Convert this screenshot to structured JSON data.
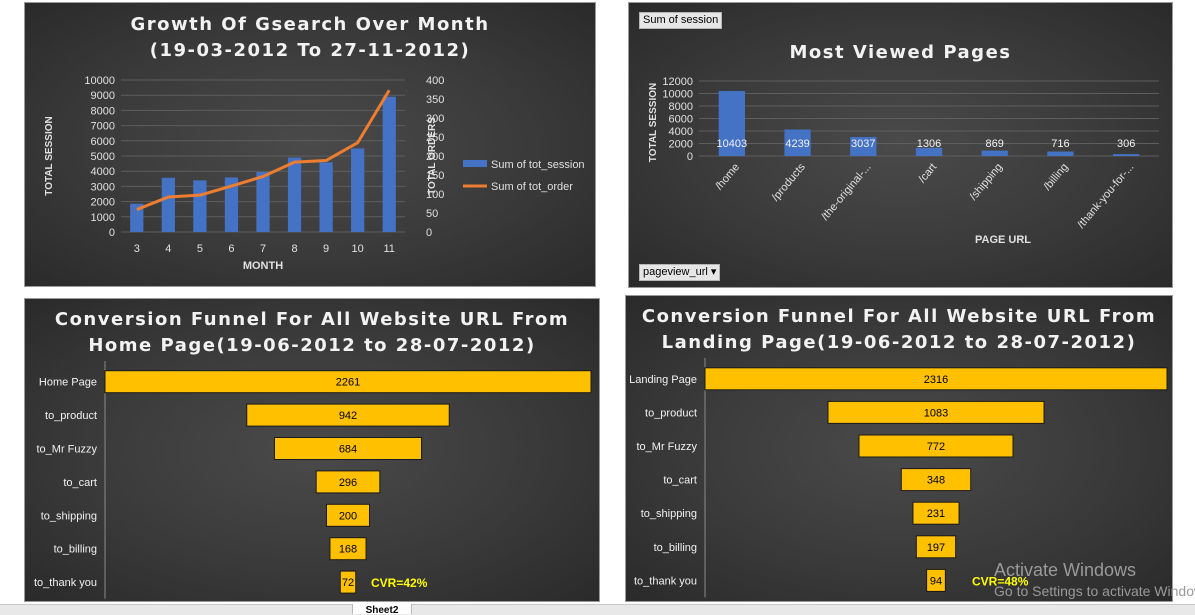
{
  "growth": {
    "title_line1": "Growth Of Gsearch Over Month",
    "title_line2": "(19-03-2012 To 27-11-2012)"
  },
  "views": {
    "title": "Most Viewed Pages",
    "filter_button": "Sum of session",
    "field_button": "pageview_url ▾"
  },
  "funnel_home": {
    "title_line1": "Conversion Funnel For All Website URL From",
    "title_line2": "Home Page(19-06-2012 to 28-07-2012)"
  },
  "funnel_landing": {
    "title_line1": "Conversion Funnel For All Website URL From",
    "title_line2": "Landing Page(19-06-2012 to 28-07-2012)"
  },
  "os_overlay": {
    "activate_title": "Activate Windows",
    "activate_sub": "Go to Settings to activate Windows."
  },
  "sheet_tab": "Sheet2",
  "colors": {
    "bar_blue": "#4472C4",
    "line_orange": "#ED7D31",
    "funnel_gold": "#FFC000",
    "cvr_yellow": "#FFFF00"
  },
  "chart_data": [
    {
      "type": "bar",
      "title": "Growth Of Gsearch Over Month (19-03-2012 To 27-11-2012)",
      "xlabel": "MONTH",
      "ylabel": "TOTAL SESSION",
      "y2label": "TOTAL ORDERS",
      "categories": [
        "3",
        "4",
        "5",
        "6",
        "7",
        "8",
        "9",
        "10",
        "11"
      ],
      "ylim": [
        0,
        10000
      ],
      "yticks": [
        0,
        1000,
        2000,
        3000,
        4000,
        5000,
        6000,
        7000,
        8000,
        9000,
        10000
      ],
      "y2lim": [
        0,
        400
      ],
      "y2ticks": [
        0,
        50,
        100,
        150,
        200,
        250,
        300,
        350,
        400
      ],
      "legend_position": "right",
      "grid": true,
      "series": [
        {
          "name": "Sum of tot_session",
          "kind": "bar",
          "axis": "left",
          "values": [
            1860,
            3570,
            3400,
            3590,
            3950,
            4900,
            4580,
            5500,
            8900
          ]
        },
        {
          "name": "Sum of tot_order",
          "kind": "line",
          "axis": "right",
          "values": [
            59,
            92,
            97,
            121,
            146,
            184,
            188,
            235,
            373
          ]
        }
      ]
    },
    {
      "type": "bar",
      "title": "Most Viewed Pages",
      "xlabel": "PAGE URL",
      "ylabel": "TOTAL SESSION",
      "categories": [
        "/home",
        "/products",
        "/the-original-...",
        "/cart",
        "/shipping",
        "/billing",
        "/thank-you-for-..."
      ],
      "values": [
        10403,
        4239,
        3037,
        1306,
        869,
        716,
        306
      ],
      "ylim": [
        0,
        12000
      ],
      "yticks": [
        0,
        2000,
        4000,
        6000,
        8000,
        10000,
        12000
      ],
      "grid": true
    },
    {
      "type": "bar",
      "orientation": "horizontal-funnel",
      "title": "Conversion Funnel For All Website URL From Home Page(19-06-2012 to 28-07-2012)",
      "categories": [
        "Home Page",
        "to_product",
        "to_Mr Fuzzy",
        "to_cart",
        "to_shipping",
        "to_billing",
        "to_thank you"
      ],
      "values": [
        2261,
        942,
        684,
        296,
        200,
        168,
        72
      ],
      "annotation": "CVR=42%"
    },
    {
      "type": "bar",
      "orientation": "horizontal-funnel",
      "title": "Conversion Funnel For All Website URL From Landing Page(19-06-2012 to 28-07-2012)",
      "categories": [
        "Landing Page",
        "to_product",
        "to_Mr Fuzzy",
        "to_cart",
        "to_shipping",
        "to_billing",
        "to_thank you"
      ],
      "values": [
        2316,
        1083,
        772,
        348,
        231,
        197,
        94
      ],
      "annotation": "CVR=48%"
    }
  ]
}
